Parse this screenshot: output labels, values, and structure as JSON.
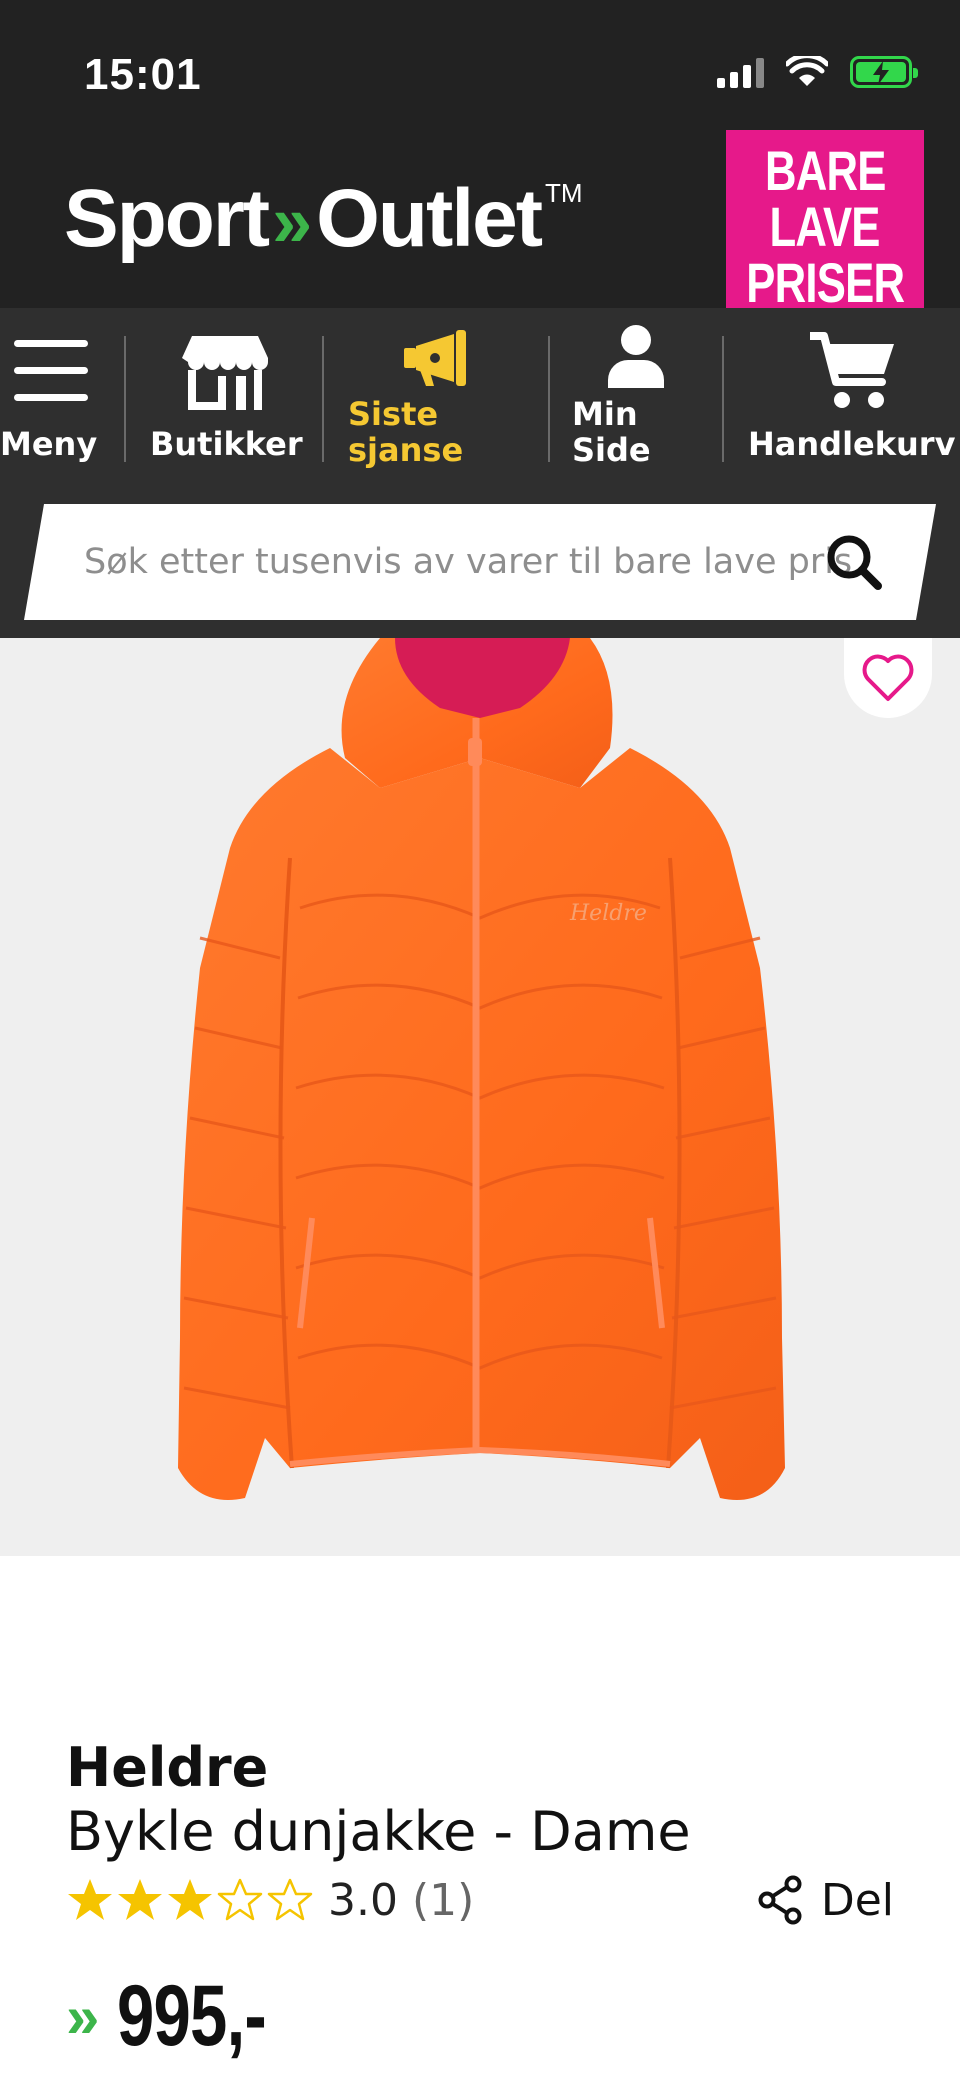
{
  "status_bar": {
    "time": "15:01"
  },
  "header": {
    "logo": {
      "part1": "Sport",
      "chevrons": "»",
      "part2": "Outlet",
      "trademark": "TM"
    },
    "badge": {
      "line1": "BARE",
      "line2": "LAVE",
      "line3": "PRISER",
      "color": "#e6198a"
    }
  },
  "nav": {
    "items": [
      {
        "label": "Meny",
        "icon": "menu-icon"
      },
      {
        "label": "Butikker",
        "icon": "store-icon"
      },
      {
        "label_line1": "Siste",
        "label_line2": "sjanse",
        "icon": "megaphone-icon",
        "color": "#f5c832"
      },
      {
        "label_line1": "Min",
        "label_line2": "Side",
        "icon": "user-icon"
      },
      {
        "label": "Handlekurv",
        "icon": "cart-icon"
      }
    ]
  },
  "search": {
    "placeholder": "Søk etter tusenvis av varer til bare lave priser",
    "icon": "search-icon"
  },
  "product": {
    "image": "orange down jacket with hood",
    "favorite_icon": "heart-icon",
    "brand": "Heldre",
    "name": "Bykle dunjakke - Dame",
    "rating": {
      "stars_filled": 3,
      "stars_total": 5,
      "value": "3.0",
      "count": "(1)"
    },
    "share": {
      "label": "Del",
      "icon": "share-icon"
    },
    "price": {
      "chevrons": "»",
      "value": "995,-"
    }
  },
  "colors": {
    "header_bg": "#222222",
    "nav_bg": "#2f2f2f",
    "brand_green": "#3cb54a",
    "accent_pink": "#e6198a",
    "accent_yellow": "#f5c832",
    "star": "#f5c400"
  }
}
